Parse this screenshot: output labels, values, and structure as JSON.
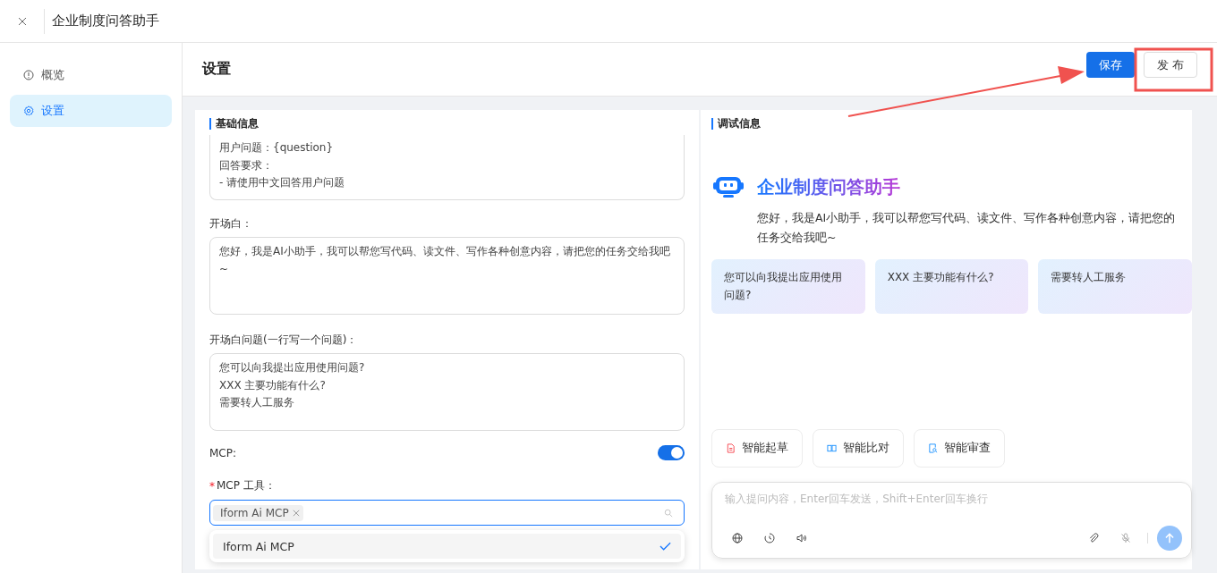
{
  "window": {
    "title": "企业制度问答助手"
  },
  "sidebar": {
    "items": [
      {
        "label": "概览",
        "selected": false
      },
      {
        "label": "设置",
        "selected": true
      }
    ]
  },
  "header": {
    "title": "设置",
    "buttons": [
      {
        "label": "保存",
        "kind": "primary"
      },
      {
        "label": "发 布",
        "kind": "default"
      }
    ]
  },
  "basic_info": {
    "title": "基础信息",
    "prompt_lines": [
      "用户问题：{question}",
      "回答要求：",
      "- 请使用中文回答用户问题"
    ],
    "opening_label": "开场白：",
    "opening_value": "您好，我是AI小助手，我可以帮您写代码、读文件、写作各种创意内容，请把您的任务交给我吧~",
    "questions_label": "开场白问题(一行写一个问题)：",
    "questions_lines": [
      "您可以向我提出应用使用问题?",
      "XXX 主要功能有什么?",
      "需要转人工服务"
    ],
    "mcp_label": "MCP:",
    "mcp_on": true,
    "tools_label": "MCP 工具：",
    "tools_required_mark": "*",
    "tools_tags": [
      "Iform Ai MCP"
    ],
    "tools_options": [
      {
        "label": "Iform Ai MCP",
        "selected": true
      }
    ]
  },
  "debug": {
    "title": "调试信息",
    "assistant_name": "企业制度问答助手",
    "greeting": "您好，我是AI小助手，我可以帮您写代码、读文件、写作各种创意内容，请把您的任务交给我吧~",
    "suggestions": [
      "您可以向我提出应用使用问题?",
      "XXX 主要功能有什么?",
      "需要转人工服务"
    ],
    "chips": [
      {
        "label": "智能起草",
        "kind": "draft"
      },
      {
        "label": "智能比对",
        "kind": "compare"
      },
      {
        "label": "智能审查",
        "kind": "review"
      }
    ],
    "input": {
      "placeholder": "输入提问内容，Enter回车发送，Shift+Enter回车换行"
    }
  }
}
